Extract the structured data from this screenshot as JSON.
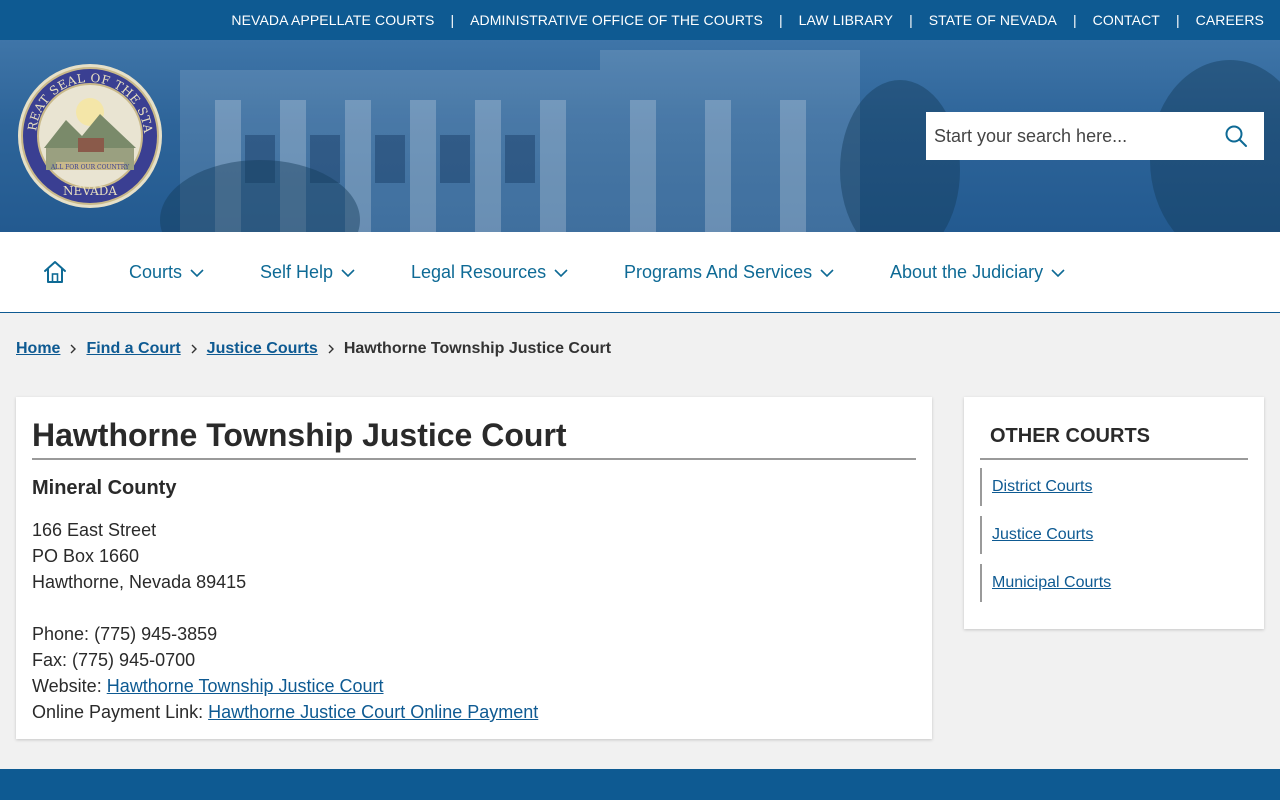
{
  "topbar": {
    "links": [
      "NEVADA APPELLATE COURTS",
      "ADMINISTRATIVE OFFICE OF THE COURTS",
      "LAW LIBRARY",
      "STATE OF NEVADA",
      "CONTACT",
      "CAREERS"
    ],
    "separator": "|"
  },
  "seal": {
    "ring_text": "THE GREAT SEAL OF THE STATE OF",
    "bottom_text": "NEVADA",
    "banner_text": "ALL FOR OUR COUNTRY"
  },
  "search": {
    "placeholder": "Start your search here...",
    "icon": "search-icon"
  },
  "nav": {
    "home_icon": "home-icon",
    "items": [
      "Courts",
      "Self Help",
      "Legal Resources",
      "Programs And Services",
      "About the Judiciary"
    ]
  },
  "breadcrumb": {
    "links": [
      "Home",
      "Find a Court",
      "Justice Courts"
    ],
    "current": "Hawthorne Township Justice Court"
  },
  "court": {
    "title": "Hawthorne Township Justice Court",
    "county": "Mineral County",
    "address": [
      "166 East Street",
      "PO Box 1660",
      "Hawthorne, Nevada 89415"
    ],
    "phone_label": "Phone:",
    "phone": "(775) 945-3859",
    "fax_label": "Fax:",
    "fax": "(775) 945-0700",
    "website_label": "Website:",
    "website_link": "Hawthorne Township Justice Court",
    "payment_label": "Online Payment Link:",
    "payment_link": "Hawthorne Justice Court Online Payment"
  },
  "sidebar": {
    "title": "OTHER COURTS",
    "links": [
      "District Courts",
      "Justice Courts",
      "Municipal Courts"
    ]
  },
  "colors": {
    "brand_blue": "#0e5a92",
    "link_blue": "#0e6a95",
    "page_bg": "#f1f1f1"
  }
}
